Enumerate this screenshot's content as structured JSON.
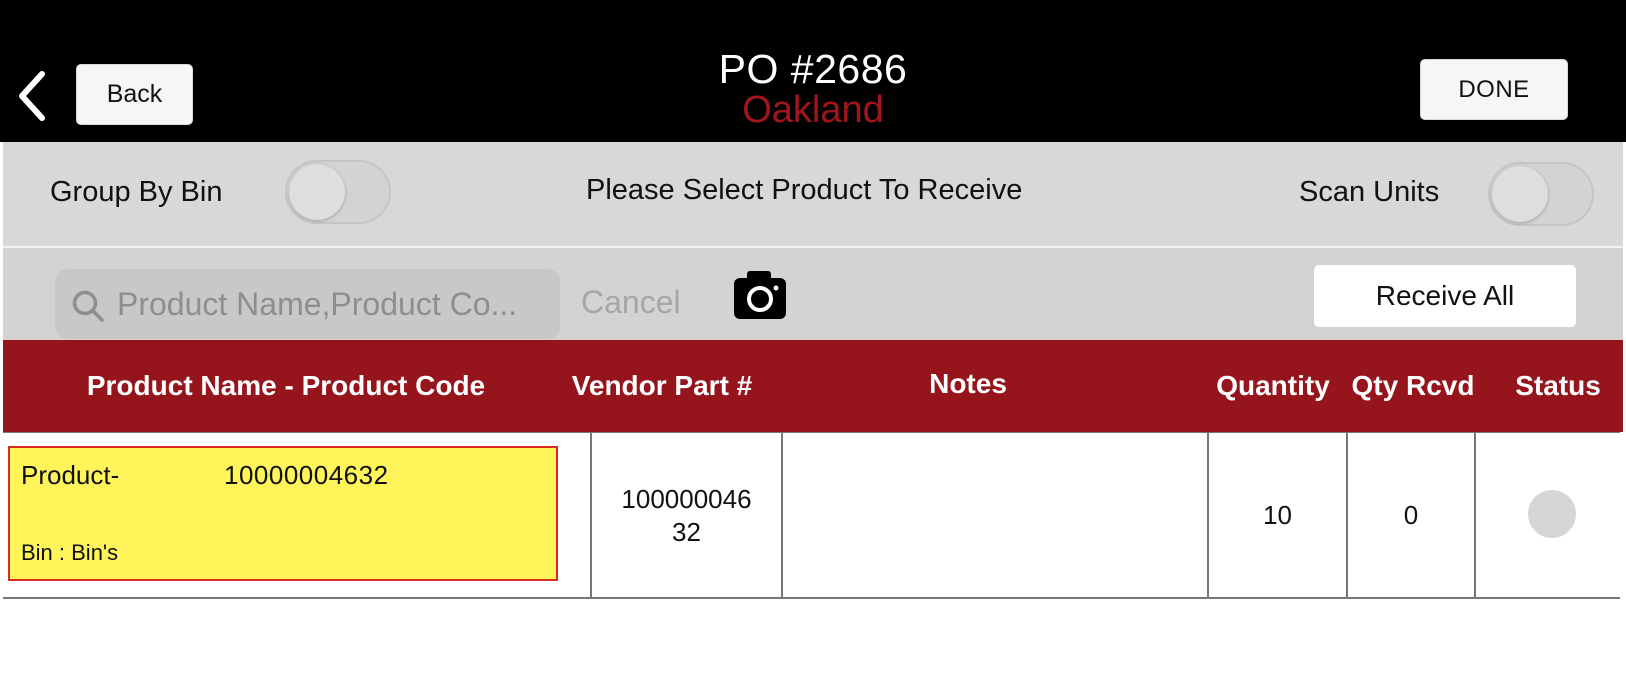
{
  "header": {
    "back_label": "Back",
    "title": "PO #2686",
    "subtitle": "Oakland",
    "done_label": "DONE",
    "accent_color": "#a3151c"
  },
  "options": {
    "group_by_bin_label": "Group By Bin",
    "group_by_bin_on": false,
    "instruction": "Please Select Product To Receive",
    "scan_units_label": "Scan Units",
    "scan_units_on": false
  },
  "search": {
    "placeholder": "Product Name,Product Co...",
    "cancel_label": "Cancel",
    "camera_icon": "camera-icon",
    "receive_all_label": "Receive All"
  },
  "table": {
    "header_color": "#96141b",
    "columns": {
      "product": "Product Name - Product Code",
      "vendor_part": "Vendor Part #",
      "notes": "Notes",
      "quantity": "Quantity",
      "qty_rcvd": "Qty Rcvd",
      "status": "Status"
    },
    "rows": [
      {
        "product_name": "Product-",
        "product_code": "10000004632",
        "bin": "Bin : Bin's",
        "vendor_part_line1": "100000046",
        "vendor_part_line2": "32",
        "notes": "",
        "quantity": "10",
        "qty_rcvd": "0",
        "highlight_color": "#fff55a"
      }
    ]
  }
}
